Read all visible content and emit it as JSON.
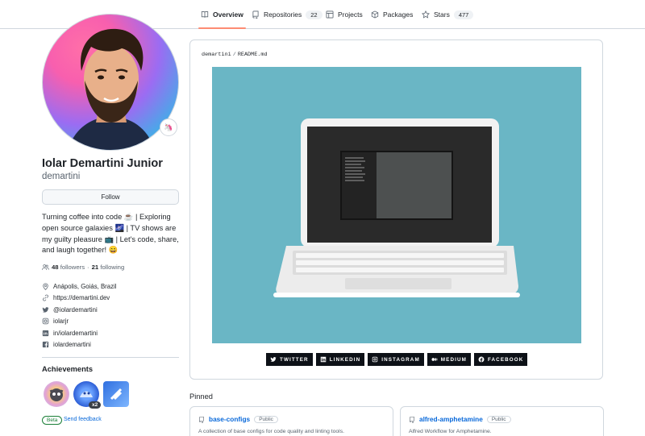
{
  "nav": {
    "tabs": [
      {
        "label": "Overview",
        "icon": "book-icon"
      },
      {
        "label": "Repositories",
        "count": "22",
        "icon": "repo-icon"
      },
      {
        "label": "Projects",
        "icon": "table-icon"
      },
      {
        "label": "Packages",
        "icon": "package-icon"
      },
      {
        "label": "Stars",
        "count": "477",
        "icon": "star-icon"
      }
    ]
  },
  "profile": {
    "fullname": "Iolar Demartini Junior",
    "login": "demartini",
    "follow_label": "Follow",
    "status_emoji": "🦄",
    "bio": "Turning coffee into code ☕ | Exploring open source galaxies 🌌 | TV shows are my guilty pleasure 📺 | Let's code, share, and laugh together! 😄",
    "followers_count": "48",
    "followers_label": "followers",
    "dot": "·",
    "following_count": "21",
    "following_label": "following",
    "vcard": [
      {
        "icon": "location-icon",
        "text": "Anápolis, Goiás, Brazil"
      },
      {
        "icon": "link-icon",
        "text": "https://demartini.dev"
      },
      {
        "icon": "twitter-icon",
        "text": "@iolardemartini"
      },
      {
        "icon": "instagram-icon",
        "text": "iolarjr"
      },
      {
        "icon": "linkedin-icon",
        "text": "in/iolardemartini"
      },
      {
        "icon": "facebook-icon",
        "text": "iolardemartini"
      }
    ]
  },
  "achievements": {
    "title": "Achievements",
    "badge_multiplier": "x2",
    "beta_label": "Beta",
    "feedback_label": "Send feedback"
  },
  "readme": {
    "owner": "demartini",
    "separator": "/",
    "file": "README.md",
    "socials": [
      {
        "label": "TWITTER",
        "icon": "twitter-icon"
      },
      {
        "label": "LINKEDIN",
        "icon": "linkedin-icon"
      },
      {
        "label": "INSTAGRAM",
        "icon": "instagram-icon"
      },
      {
        "label": "MEDIUM",
        "icon": "medium-icon"
      },
      {
        "label": "FACEBOOK",
        "icon": "facebook-icon"
      }
    ]
  },
  "pinned": {
    "title": "Pinned",
    "repos": [
      {
        "name": "base-configs",
        "visibility": "Public",
        "description": "A collection of base configs for code quality and linting tools."
      },
      {
        "name": "alfred-amphetamine",
        "visibility": "Public",
        "description": "Alfred Workflow for Amphetamine."
      }
    ]
  },
  "colors": {
    "accent_underline": "#fd8c73",
    "link_blue": "#0969da",
    "hero_background": "#6ab6c5",
    "social_badge": "#0d1117"
  }
}
